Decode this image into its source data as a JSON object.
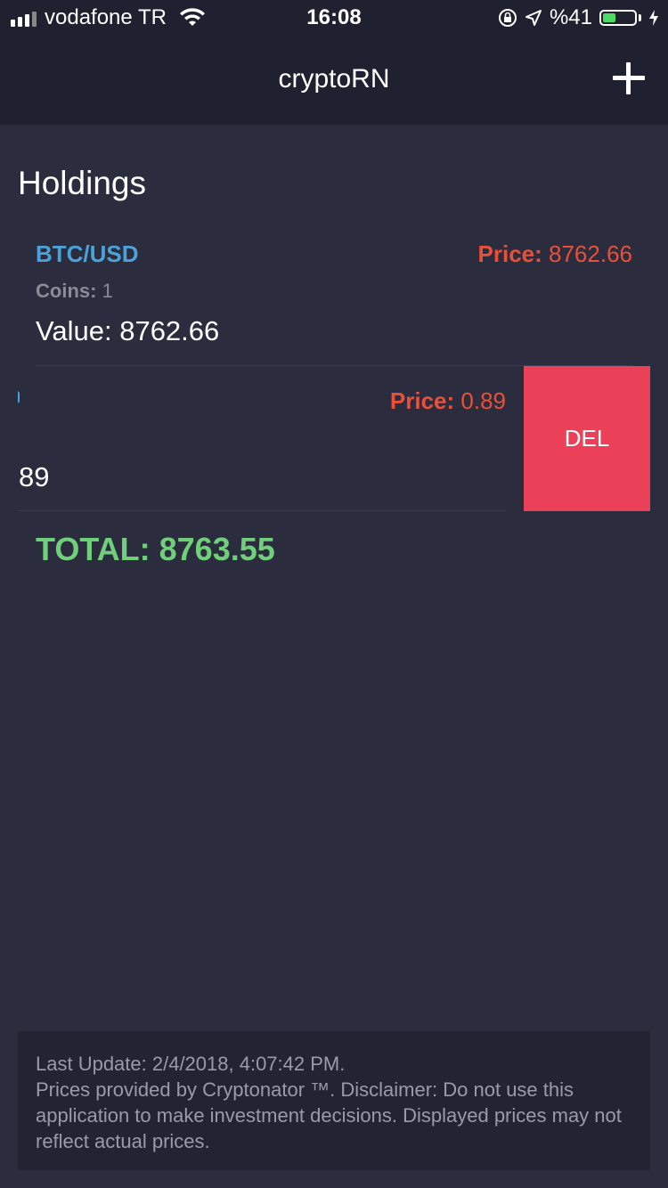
{
  "status_bar": {
    "carrier": "vodafone TR",
    "time": "16:08",
    "battery_percent": "%41",
    "battery_level": 0.41,
    "icons": [
      "signal-icon",
      "wifi-icon",
      "orientation-lock-icon",
      "location-icon",
      "battery-icon",
      "charging-icon"
    ]
  },
  "navbar": {
    "title": "cryptoRN",
    "add_icon": "plus-icon"
  },
  "section_title": "Holdings",
  "holdings": [
    {
      "pair": "BTC/USD",
      "price_label": "Price:",
      "price_value": "8762.66",
      "coins_label": "Coins:",
      "coins_value": "1",
      "value_text": "Value: 8762.66"
    },
    {
      "price_label": "Price:",
      "price_value": "0.89",
      "value_text_visible": "89"
    }
  ],
  "delete_label": "DEL",
  "total_text": "TOTAL: 8763.55",
  "footer": {
    "last_update": "Last Update: 2/4/2018, 4:07:42 PM.",
    "disclaimer": "Prices provided by Cryptonator ™. Disclaimer: Do not use this application to make investment decisions. Displayed prices may not reflect actual prices."
  },
  "colors": {
    "background": "#2b2c3e",
    "header": "#1f2030",
    "pair": "#4aa3d8",
    "price": "#e8503a",
    "total": "#6fcf7a",
    "delete": "#ea4158"
  }
}
